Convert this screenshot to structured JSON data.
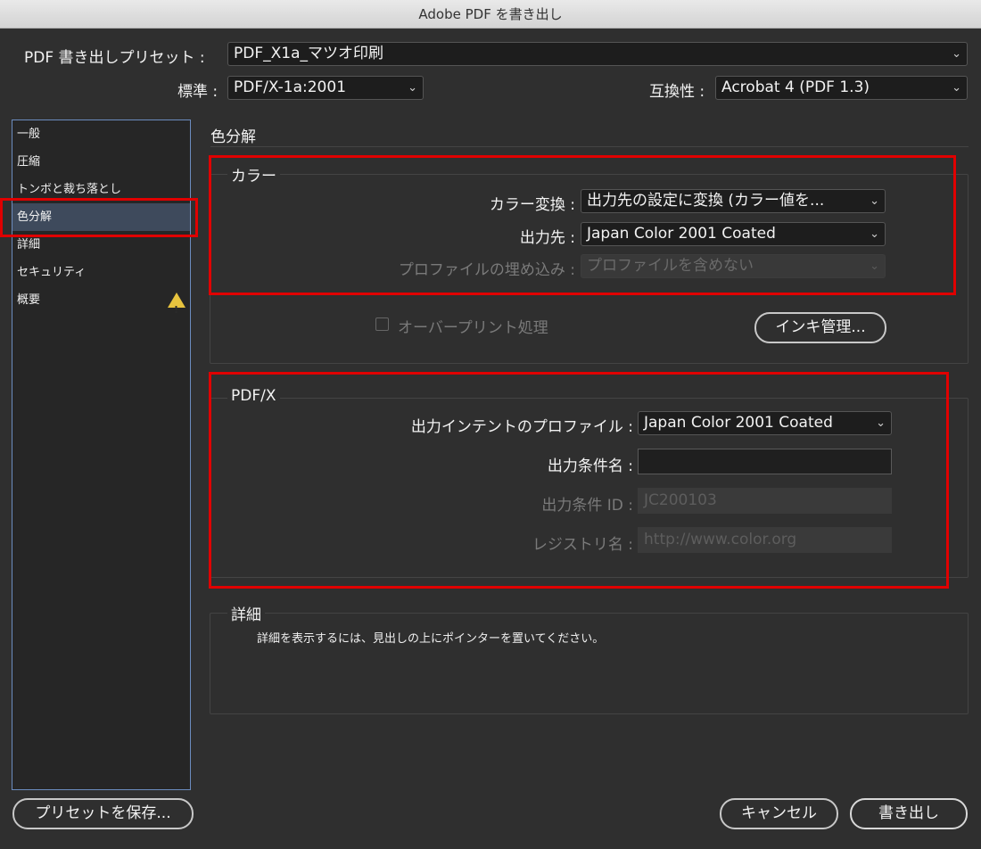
{
  "window": {
    "title": "Adobe PDF を書き出し"
  },
  "header": {
    "preset_label": "PDF 書き出しプリセット :",
    "preset_value": "PDF_X1a_マツオ印刷",
    "standard_label": "標準 :",
    "standard_value": "PDF/X-1a:2001",
    "compat_label": "互換性 :",
    "compat_value": "Acrobat 4 (PDF 1.3)"
  },
  "sidebar": {
    "items": [
      {
        "label": "一般"
      },
      {
        "label": "圧縮"
      },
      {
        "label": "トンボと裁ち落とし"
      },
      {
        "label": "色分解"
      },
      {
        "label": "詳細"
      },
      {
        "label": "セキュリティ"
      },
      {
        "label": "概要"
      }
    ],
    "selected": "色分解",
    "warning_glyph": "!"
  },
  "main": {
    "section_title": "色分解",
    "color_group": {
      "title": "カラー",
      "conversion_label": "カラー変換 :",
      "conversion_value": "出力先の設定に変換 (カラー値を...",
      "destination_label": "出力先 :",
      "destination_value": "Japan Color 2001 Coated",
      "profile_label": "プロファイルの埋め込み :",
      "profile_value": "プロファイルを含めない",
      "overprint_label": "オーバープリント処理",
      "ink_button": "インキ管理..."
    },
    "pdfx_group": {
      "title": "PDF/X",
      "intent_label": "出力インテントのプロファイル :",
      "intent_value": "Japan Color 2001 Coated",
      "condition_name_label": "出力条件名 :",
      "condition_name_value": "",
      "condition_id_label": "出力条件 ID :",
      "condition_id_value": "JC200103",
      "registry_label": "レジストリ名 :",
      "registry_value": "http://www.color.org"
    },
    "detail_group": {
      "title": "詳細",
      "hint": "詳細を表示するには、見出しの上にポインターを置いてください。"
    }
  },
  "footer": {
    "save_preset": "プリセットを保存...",
    "cancel": "キャンセル",
    "export": "書き出し"
  },
  "icons": {
    "chevron": "⌄"
  },
  "colors": {
    "highlight": "#e00000",
    "accent": "#6b8cbf",
    "warning": "#e7c33e"
  }
}
